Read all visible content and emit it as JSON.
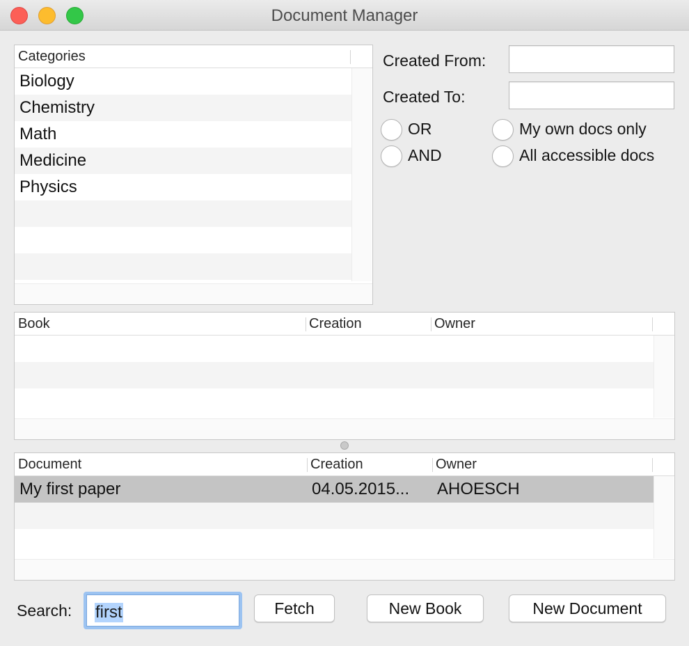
{
  "window": {
    "title": "Document Manager"
  },
  "categories": {
    "header": "Categories",
    "items": [
      "Biology",
      "Chemistry",
      "Math",
      "Medicine",
      "Physics"
    ]
  },
  "filters": {
    "created_from_label": "Created From:",
    "created_from_value": "",
    "created_to_label": "Created To:",
    "created_to_value": "",
    "logic_options": [
      "OR",
      "AND"
    ],
    "scope_options": [
      "My own docs only",
      "All accessible docs"
    ]
  },
  "books": {
    "columns": [
      "Book",
      "Creation",
      "Owner"
    ],
    "rows": []
  },
  "documents": {
    "columns": [
      "Document",
      "Creation",
      "Owner"
    ],
    "rows": [
      {
        "name": "My first paper",
        "creation": "04.05.2015...",
        "owner": "AHOESCH",
        "selected": true
      }
    ]
  },
  "bottom": {
    "search_label": "Search:",
    "search_value": "first",
    "fetch_label": "Fetch",
    "new_book_label": "New Book",
    "new_document_label": "New Document"
  },
  "colors": {
    "selection_row": "#c4c4c4",
    "focus_ring": "#9cc3f1",
    "text_selection": "#b3d4fd"
  }
}
